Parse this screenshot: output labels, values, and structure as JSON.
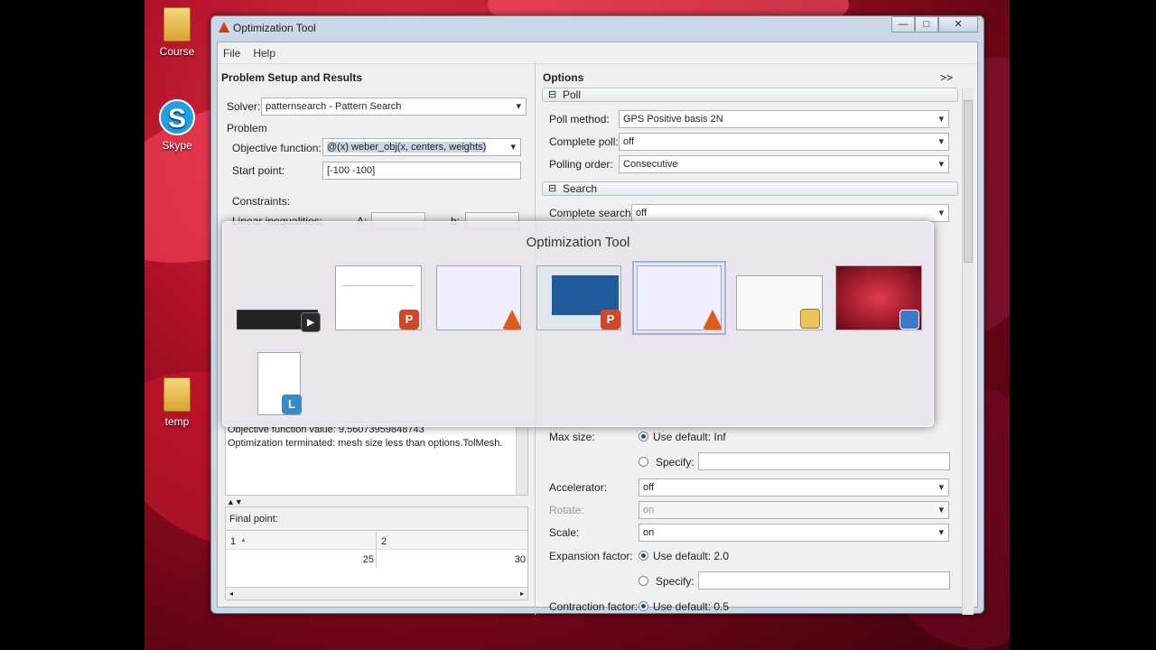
{
  "desktop": {
    "icons": [
      {
        "label": "Course"
      },
      {
        "label": "Skype"
      },
      {
        "label": "temp"
      }
    ]
  },
  "window": {
    "title": "Optimization Tool",
    "controls": {
      "minimize": "—",
      "maximize": "□",
      "close": "✕"
    },
    "menu": [
      "File",
      "Help"
    ]
  },
  "left_panel": {
    "title": "Problem Setup and Results",
    "solver_label": "Solver:",
    "solver_value": "patternsearch - Pattern Search",
    "problem_label": "Problem",
    "objective_label": "Objective function:",
    "objective_value": "@(x) weber_obj(x, centers, weights)",
    "start_label": "Start point:",
    "start_value": "[-100 -100]",
    "constraints_label": "Constraints:",
    "linear_ineq_label": "Linear inequalities:",
    "a_label": "A:",
    "b_label": "b:",
    "output_lines": [
      "Objective function value: 9.56073959848743",
      "Optimization terminated: mesh size less than options.TolMesh."
    ],
    "final_point_label": "Final point:",
    "final_point_headers": [
      "1",
      "2"
    ],
    "final_point_values": [
      "25",
      "30"
    ]
  },
  "right_panel": {
    "title": "Options",
    "expand": ">>",
    "poll_section": "Poll",
    "poll_method_label": "Poll method:",
    "poll_method_value": "GPS Positive basis 2N",
    "complete_poll_label": "Complete poll:",
    "complete_poll_value": "off",
    "polling_order_label": "Polling order:",
    "polling_order_value": "Consecutive",
    "search_section": "Search",
    "complete_search_label": "Complete search:",
    "complete_search_value": "off",
    "max_size_label": "Max size:",
    "max_size_default": "Use default: Inf",
    "specify_label": "Specify:",
    "accelerator_label": "Accelerator:",
    "accelerator_value": "off",
    "rotate_label": "Rotate:",
    "rotate_value": "on",
    "scale_label": "Scale:",
    "scale_value": "on",
    "expansion_label": "Expansion factor:",
    "expansion_default": "Use default: 2.0",
    "contraction_label": "Contraction factor:",
    "contraction_default": "Use default: 0.5"
  },
  "task_switcher": {
    "title": "Optimization Tool"
  }
}
